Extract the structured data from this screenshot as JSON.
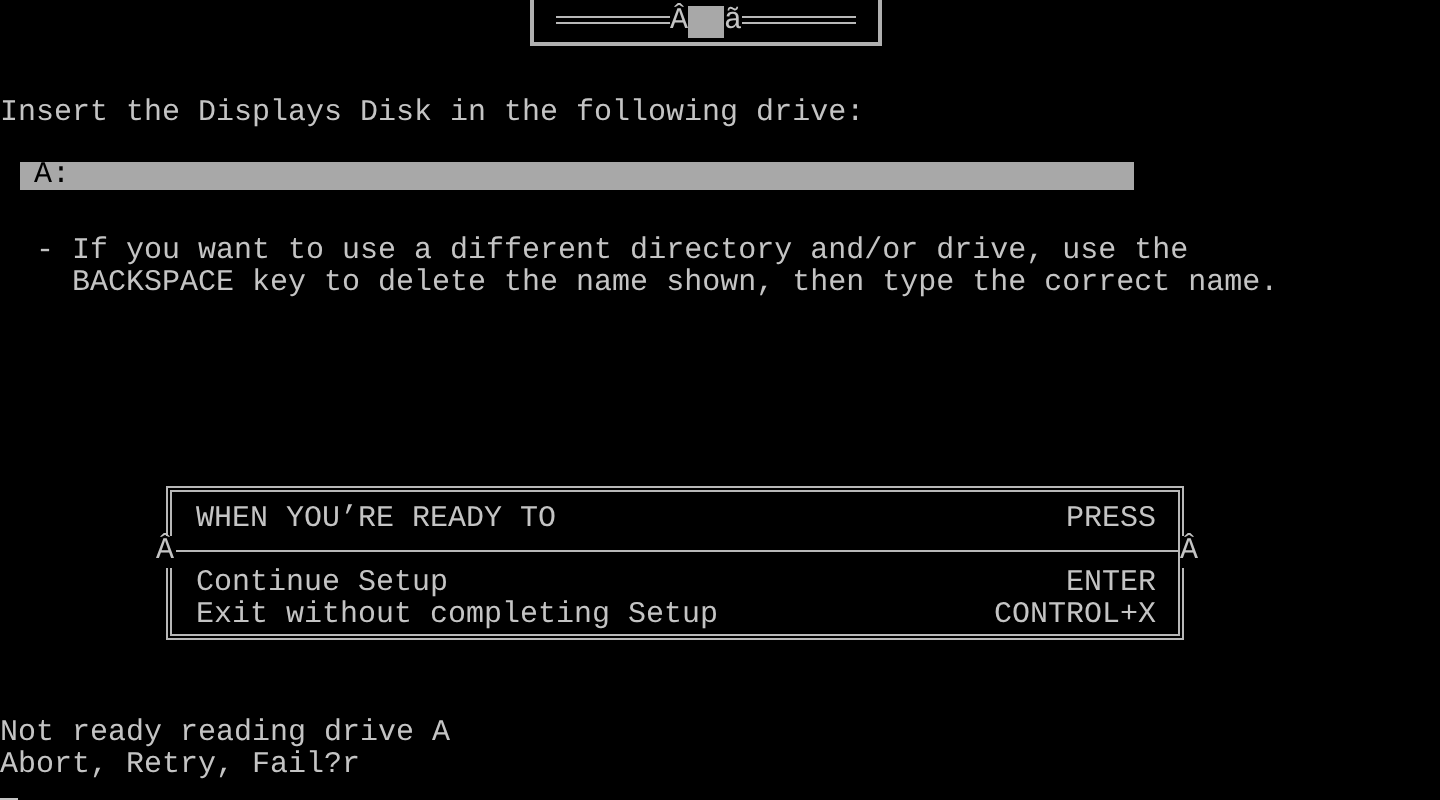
{
  "top_box": {
    "left_glyph": "Â",
    "right_glyph": "ã"
  },
  "prompt": "Insert the Displays Disk in the following drive:",
  "drive_field": {
    "value": "A:"
  },
  "hint": {
    "bullet": "-",
    "text": "If you want to use a different directory and/or drive, use the\nBACKSPACE key to delete the name shown, then type the correct name."
  },
  "dialog": {
    "header": {
      "action": "WHEN YOU’RE READY TO",
      "key": "PRESS"
    },
    "divider_glyphs": [
      "Â",
      "Â"
    ],
    "options": [
      {
        "action": "Continue Setup",
        "key": "ENTER"
      },
      {
        "action": "Exit without completing Setup",
        "key": "CONTROL+X"
      }
    ]
  },
  "console": [
    "Not ready reading drive A",
    "Abort, Retry, Fail?r"
  ]
}
